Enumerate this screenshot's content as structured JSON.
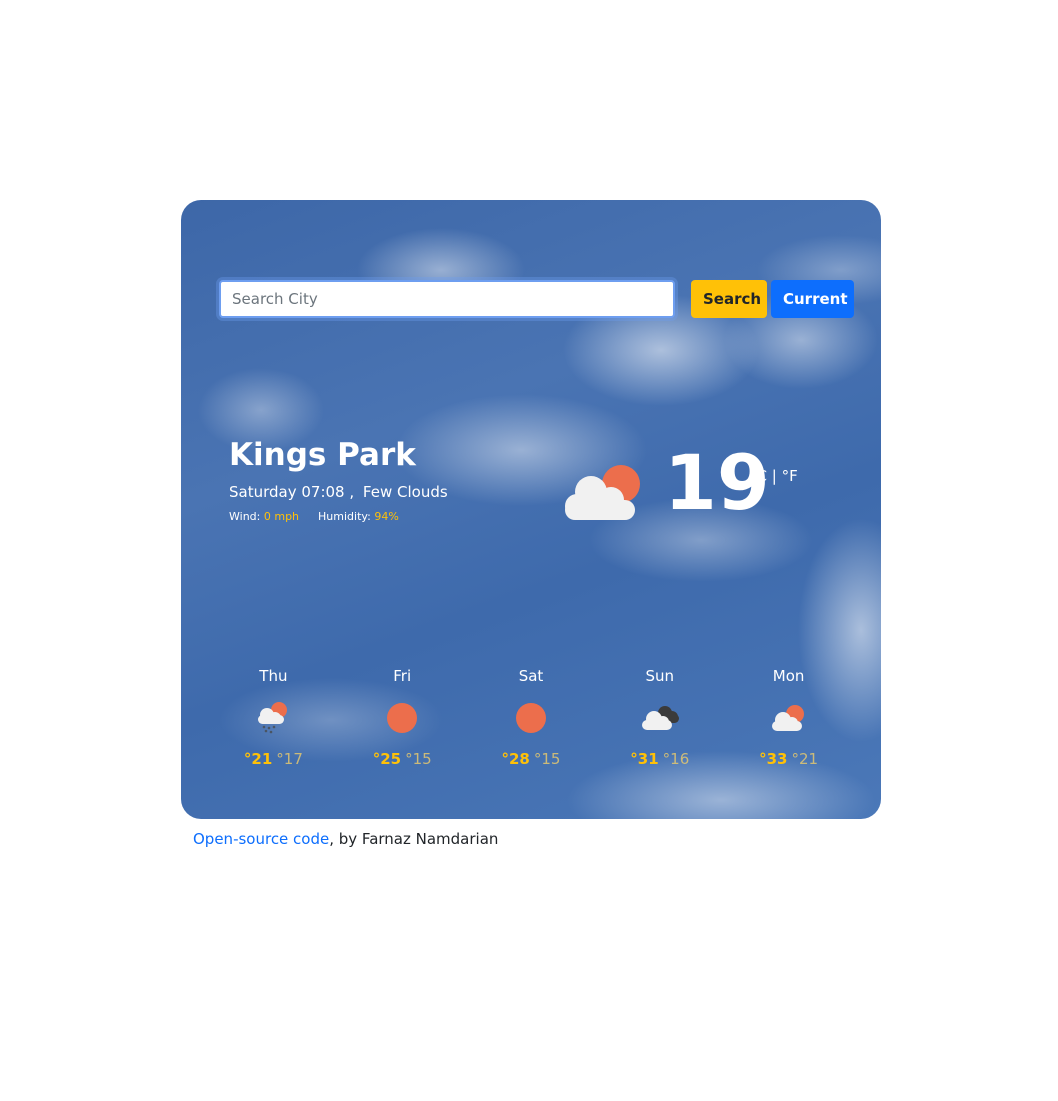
{
  "search": {
    "placeholder": "Search City",
    "value": "",
    "search_label": "Search",
    "current_label": "Current"
  },
  "current": {
    "city": "Kings Park",
    "day_time": "Saturday 07:08 ,",
    "description": "Few Clouds",
    "wind_label": "Wind:",
    "wind_value": "0 mph",
    "humidity_label": "Humidity:",
    "humidity_value": "94%",
    "temperature": "19",
    "units": "°C | °F",
    "icon": "cloud-sun-icon"
  },
  "forecast": [
    {
      "day": "Thu",
      "icon": "rain-cloud-sun-icon",
      "max": "°21",
      "min": "°17"
    },
    {
      "day": "Fri",
      "icon": "sun-icon",
      "max": "°25",
      "min": "°15"
    },
    {
      "day": "Sat",
      "icon": "sun-icon",
      "max": "°28",
      "min": "°15"
    },
    {
      "day": "Sun",
      "icon": "dark-cloud-icon",
      "max": "°31",
      "min": "°16"
    },
    {
      "day": "Mon",
      "icon": "cloud-sun-icon",
      "max": "°33",
      "min": "°21"
    }
  ],
  "footer": {
    "link_text": "Open-source code",
    "rest_text": ", by Farnaz Namdarian"
  },
  "colors": {
    "accent_yellow": "#ffc107",
    "accent_blue": "#0d6efd",
    "sun": "#ec6e4c",
    "cloud": "#f1f1f1"
  }
}
